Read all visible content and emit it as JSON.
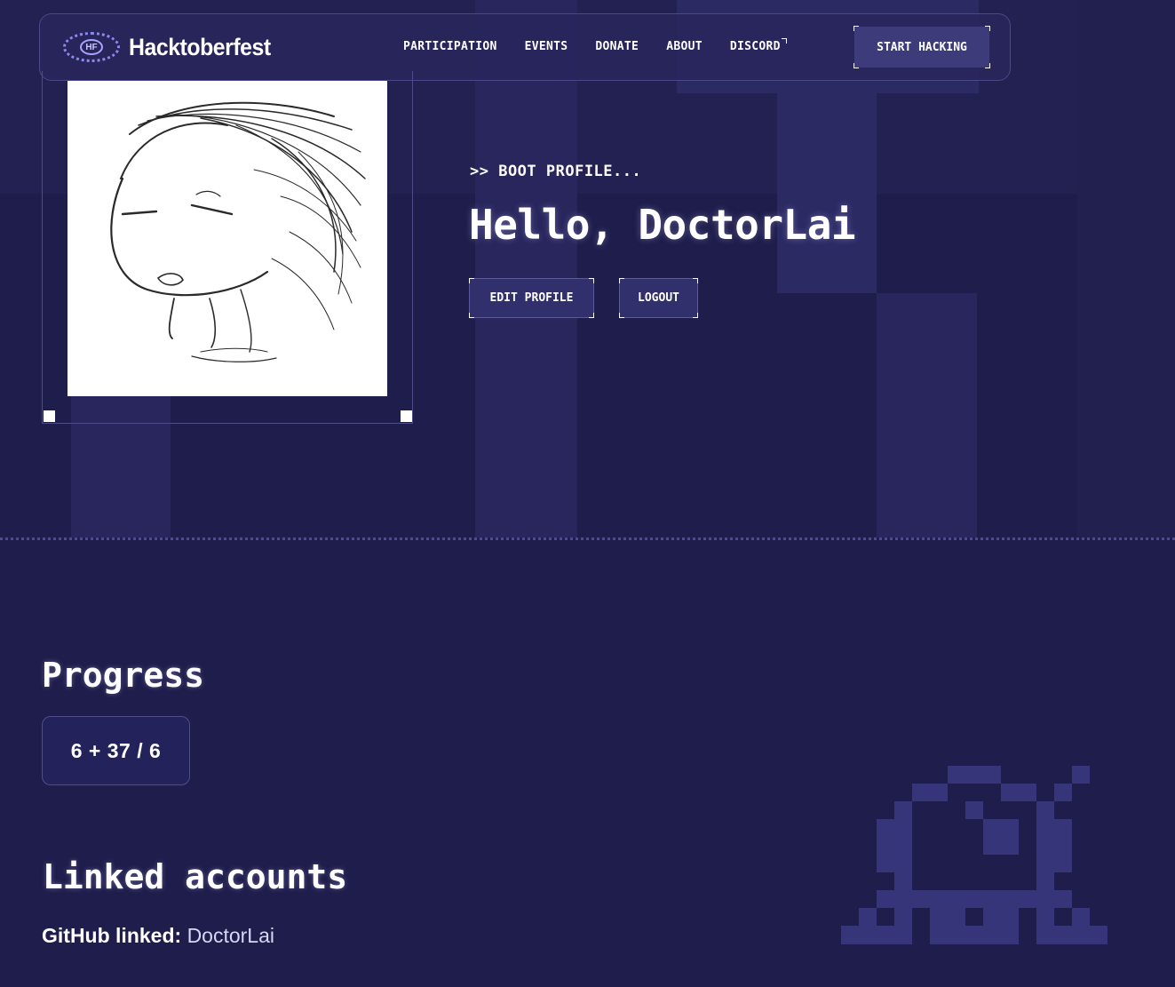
{
  "header": {
    "logo_abbr": "HF",
    "logo_text": "Hacktoberfest",
    "nav": [
      {
        "label": "PARTICIPATION"
      },
      {
        "label": "EVENTS"
      },
      {
        "label": "DONATE"
      },
      {
        "label": "ABOUT"
      },
      {
        "label": "DISCORD"
      }
    ],
    "cta_label": "START HACKING"
  },
  "profile": {
    "boot_text": ">> BOOT PROFILE...",
    "greeting": "Hello, DoctorLai",
    "edit_label": "EDIT PROFILE",
    "logout_label": "LOGOUT"
  },
  "progress": {
    "title": "Progress",
    "value": "6 + 37 / 6"
  },
  "linked": {
    "title": "Linked accounts",
    "github_label": "GitHub linked:",
    "github_value": "DoctorLai"
  },
  "colors": {
    "background": "#1f1d4b",
    "accent": "#8d88ee",
    "button": "#312f6c"
  }
}
